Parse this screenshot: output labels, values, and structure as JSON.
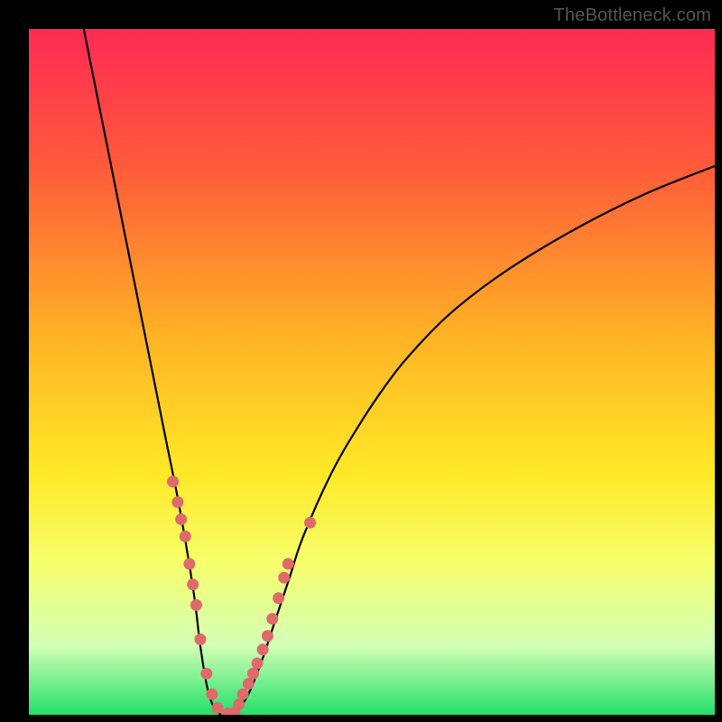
{
  "watermark": "TheBottleneck.com",
  "chart_data": {
    "type": "line",
    "title": "",
    "xlabel": "",
    "ylabel": "",
    "xlim": [
      0,
      100
    ],
    "ylim": [
      0,
      100
    ],
    "grid": false,
    "legend": false,
    "gradient_stops": [
      {
        "offset": 0,
        "color": "#ff2a55"
      },
      {
        "offset": 20,
        "color": "#ff5a3a"
      },
      {
        "offset": 45,
        "color": "#ffb324"
      },
      {
        "offset": 65,
        "color": "#ffe927"
      },
      {
        "offset": 78,
        "color": "#f6ff6c"
      },
      {
        "offset": 90,
        "color": "#d2ffb6"
      },
      {
        "offset": 100,
        "color": "#22e06a"
      }
    ],
    "series": [
      {
        "name": "left-curve",
        "type": "line",
        "x": [
          8,
          10,
          12,
          14,
          16,
          18,
          20,
          22,
          24,
          25,
          26,
          27,
          28
        ],
        "values": [
          100,
          90,
          80,
          70,
          60,
          50,
          40,
          30,
          18,
          10,
          4,
          1,
          0
        ]
      },
      {
        "name": "right-curve",
        "type": "line",
        "x": [
          30,
          32,
          34,
          36,
          38,
          40,
          44,
          48,
          52,
          56,
          62,
          70,
          80,
          90,
          100
        ],
        "values": [
          0,
          3,
          8,
          14,
          20,
          26,
          35,
          42,
          48,
          53,
          59,
          65,
          71,
          76,
          80
        ]
      },
      {
        "name": "left-branch-dots",
        "type": "scatter",
        "x": [
          21.0,
          21.7,
          22.2,
          22.8,
          23.4,
          23.9,
          24.4,
          25.0,
          25.9,
          26.7,
          27.5,
          29.0
        ],
        "values": [
          34.0,
          31.0,
          28.5,
          26.0,
          22.0,
          19.0,
          16.0,
          11.0,
          6.0,
          3.0,
          1.0,
          0.2
        ]
      },
      {
        "name": "right-branch-dots",
        "type": "scatter",
        "x": [
          30.0,
          30.6,
          31.2,
          32.0,
          32.7,
          33.3,
          34.1,
          34.8,
          35.5,
          36.4,
          37.2,
          37.8,
          41.0
        ],
        "values": [
          0.3,
          1.5,
          3.0,
          4.5,
          6.0,
          7.5,
          9.5,
          11.5,
          14.0,
          17.0,
          20.0,
          22.0,
          28.0
        ]
      }
    ],
    "dot_color": "#de6a6a",
    "line_color": "#000000"
  }
}
